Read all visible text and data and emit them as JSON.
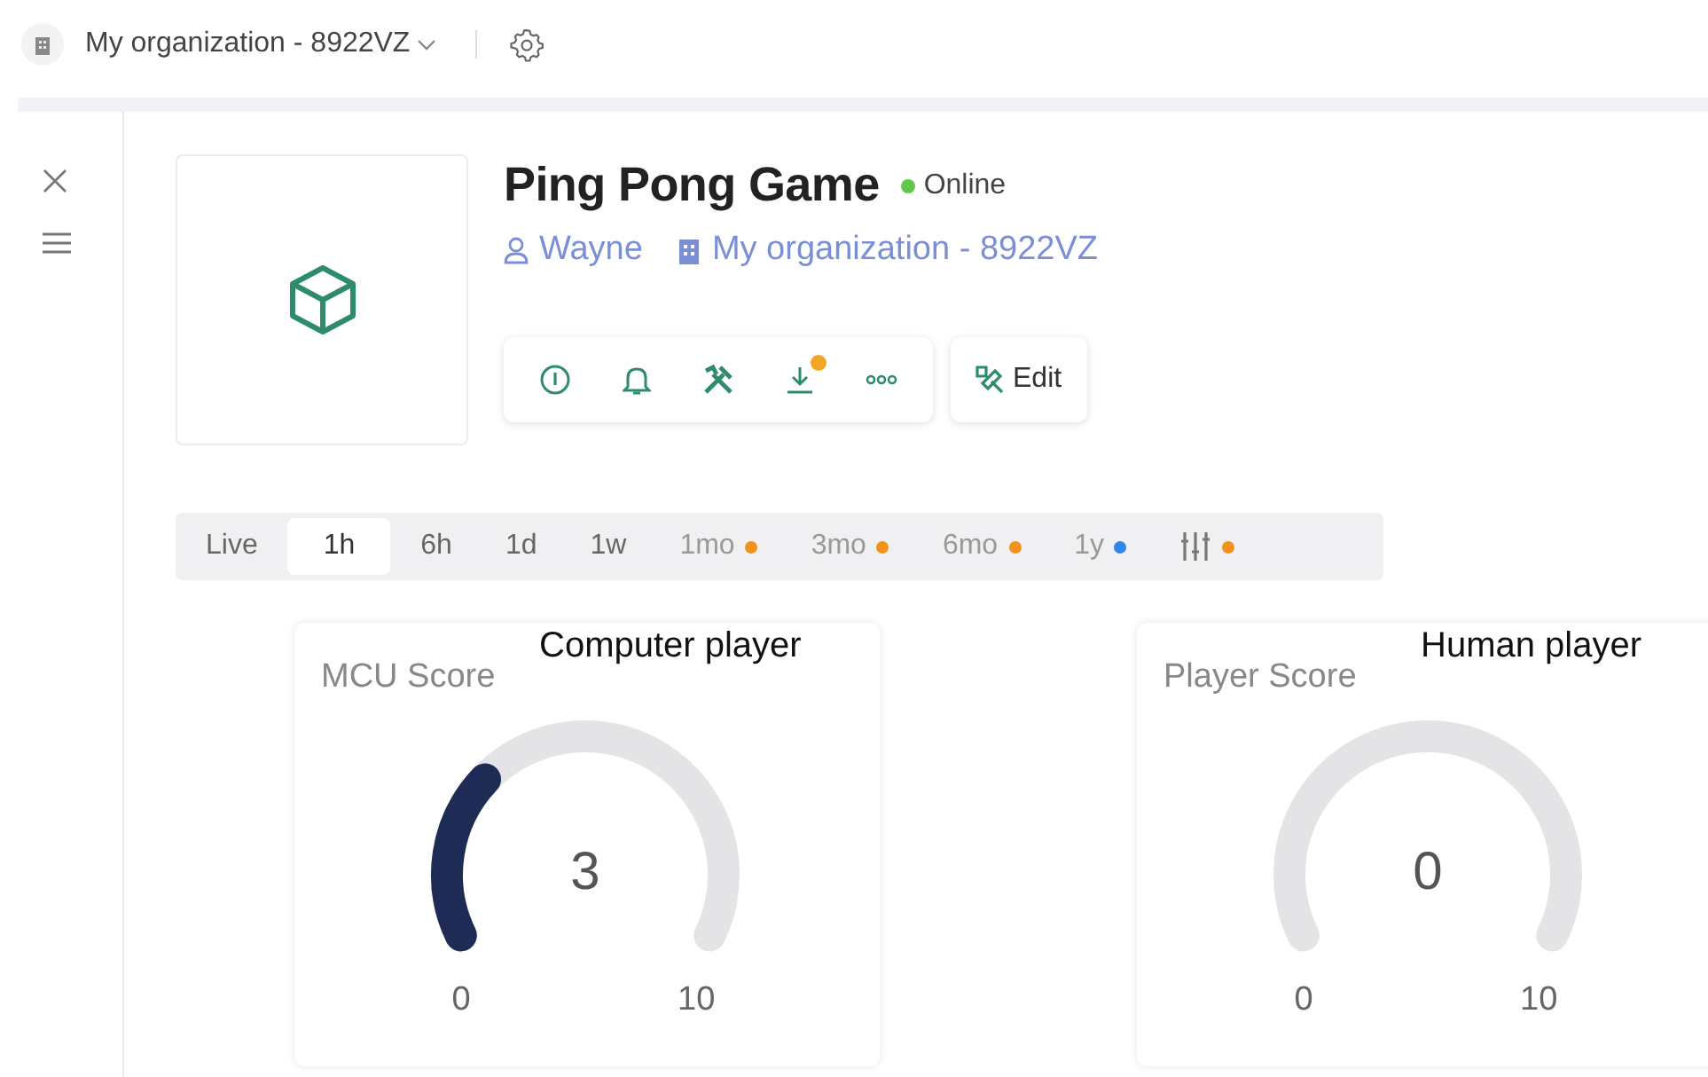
{
  "top_bar": {
    "organization": "My organization - 8922VZ"
  },
  "device": {
    "title": "Ping Pong Game",
    "status": "Online",
    "online": true,
    "owner": "Wayne",
    "organization": "My organization - 8922VZ",
    "actions": [
      {
        "kind": "info",
        "dot": false
      },
      {
        "kind": "bell",
        "dot": false
      },
      {
        "kind": "tools",
        "dot": false
      },
      {
        "kind": "download",
        "dot": true
      },
      {
        "kind": "more",
        "dot": false
      }
    ],
    "edit_label": "Edit"
  },
  "time_ranges": [
    {
      "kind": "text",
      "label": "Live",
      "selected": false
    },
    {
      "kind": "text",
      "label": "1h",
      "selected": true
    },
    {
      "kind": "text",
      "label": "6h",
      "selected": false
    },
    {
      "kind": "text",
      "label": "1d",
      "selected": false
    },
    {
      "kind": "text",
      "label": "1w",
      "selected": false
    },
    {
      "kind": "text",
      "label": "1mo",
      "selected": false,
      "color": "#f0921c"
    },
    {
      "kind": "text",
      "label": "3mo",
      "selected": false,
      "color": "#f0921c"
    },
    {
      "kind": "text",
      "label": "6mo",
      "selected": false,
      "color": "#f0921c"
    },
    {
      "kind": "text",
      "label": "1y",
      "selected": false,
      "color": "#2f86e8"
    },
    {
      "kind": "icon",
      "selected": false,
      "color": "#f0921c"
    }
  ],
  "gauges": [
    {
      "title": "MCU Score",
      "annotation": "Computer player",
      "value": "3",
      "min": "0",
      "max": "10"
    },
    {
      "title": "Player Score",
      "annotation": "Human player",
      "value": "0",
      "min": "0",
      "max": "10"
    }
  ]
}
